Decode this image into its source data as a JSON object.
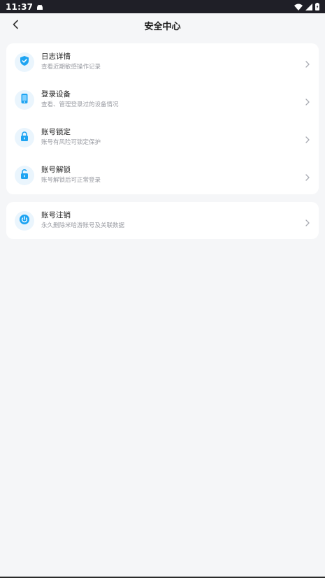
{
  "status_bar": {
    "time": "11:37",
    "icons": [
      "android-notification-icon",
      "wifi-icon",
      "signal-icon",
      "battery-icon"
    ]
  },
  "header": {
    "title": "安全中心",
    "back_icon": "chevron-left-icon"
  },
  "colors": {
    "background": "#f5f6f8",
    "card": "#ffffff",
    "accent": "#1ea4f2",
    "icon_bg": "#eaf5fd",
    "title": "#222222",
    "subtitle": "#9a9ca3",
    "status_bar": "#1f1f27"
  },
  "security_items": [
    {
      "title": "日志详情",
      "subtitle": "查看近期敏感操作记录",
      "icon": "shield-check-icon"
    },
    {
      "title": "登录设备",
      "subtitle": "查看、管理登录过的设备情况",
      "icon": "phone-device-icon"
    },
    {
      "title": "账号锁定",
      "subtitle": "账号有风险可锁定保护",
      "icon": "lock-icon"
    },
    {
      "title": "账号解锁",
      "subtitle": "账号解锁后可正常登录",
      "icon": "unlock-icon"
    }
  ],
  "account_items": [
    {
      "title": "账号注销",
      "subtitle": "永久删除米哈游账号及关联数据",
      "icon": "power-icon"
    }
  ]
}
